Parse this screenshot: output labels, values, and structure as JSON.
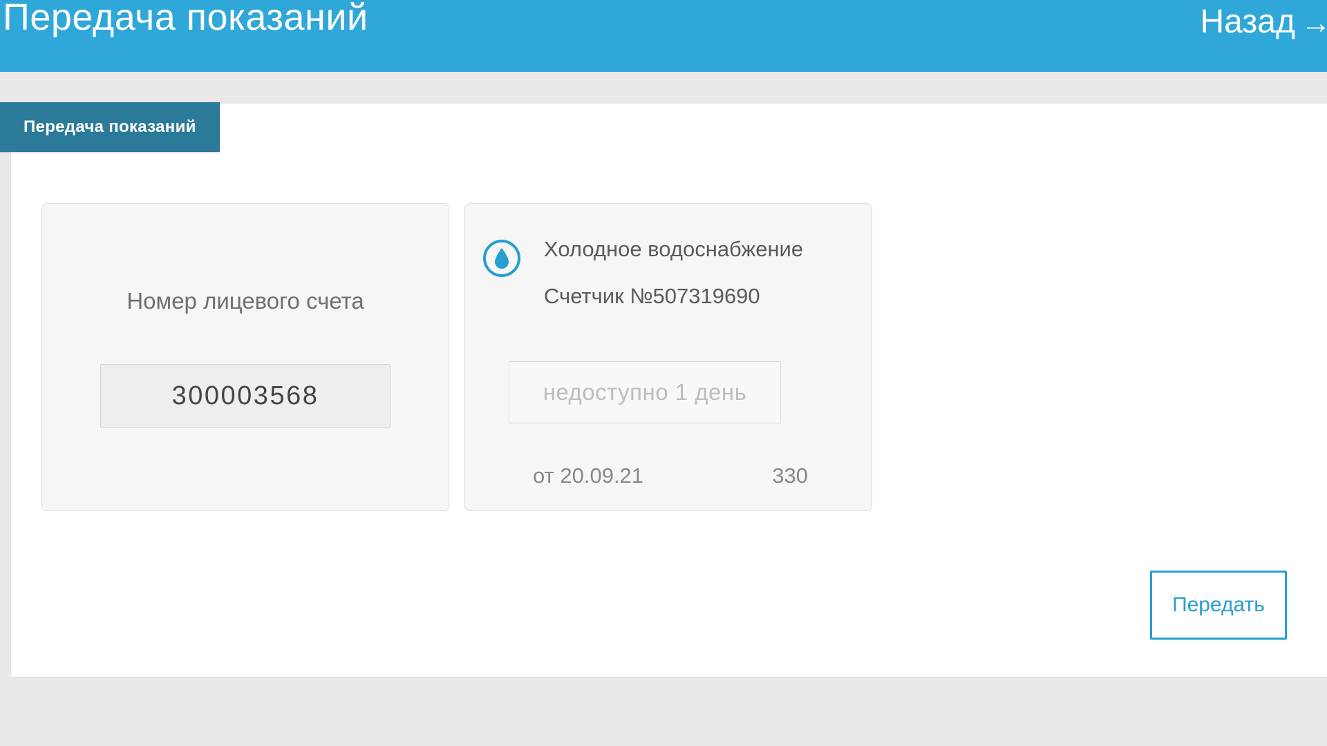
{
  "header": {
    "title": "Передача показаний",
    "back_label": "Назад"
  },
  "tab": {
    "label": "Передача показаний"
  },
  "account": {
    "label": "Номер лицевого счета",
    "value": "300003568"
  },
  "meter": {
    "service_name": "Холодное водоснабжение",
    "meter_label": "Счетчик №507319690",
    "input_placeholder": "недоступно 1 день",
    "prev_date": "от 20.09.21",
    "prev_value": "330"
  },
  "actions": {
    "submit_label": "Передать"
  },
  "colors": {
    "primary": "#2fa7d8",
    "tab": "#2c7a99",
    "accent": "#269fcf"
  }
}
